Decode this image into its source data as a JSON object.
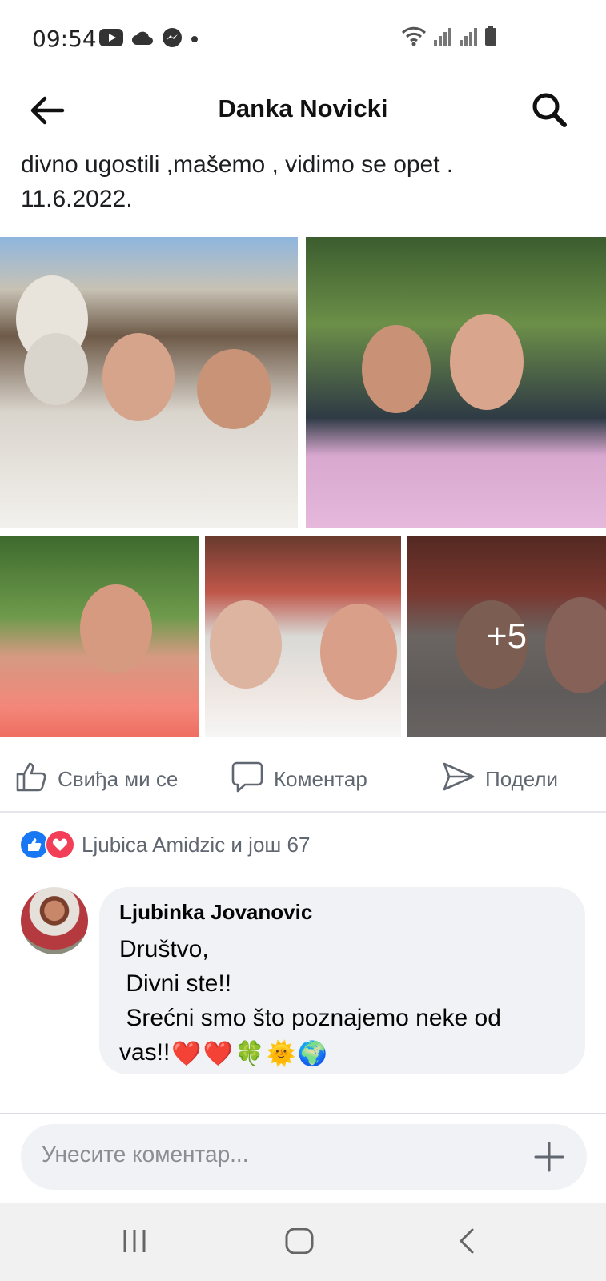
{
  "status_bar": {
    "time": "09:54",
    "left_icons": [
      "youtube-icon",
      "cloud-icon",
      "messenger-icon",
      "dot-icon"
    ],
    "right_icons": [
      "wifi-icon",
      "signal-icon",
      "signal-icon",
      "battery-icon"
    ]
  },
  "header": {
    "title": "Danka Novicki",
    "back_icon": "arrow-left-icon",
    "search_icon": "search-icon"
  },
  "post": {
    "caption": "divno ugostili ,mašemo , vidimo se opet .\n11.6.2022.",
    "more_photos_label": "+5"
  },
  "actions": {
    "like_label": "Свиђа ми се",
    "comment_label": "Коментар",
    "share_label": "Подели"
  },
  "reactions": {
    "summary": "Ljubica Amidzic и још 67",
    "types": [
      "like",
      "love"
    ],
    "colors": {
      "like": "#1877f2",
      "love": "#f33e58"
    }
  },
  "comment": {
    "author": "Ljubinka Jovanovic",
    "text": "Društvo,\n Divni ste!!\n Srećni smo što poznajemo neke od\nvas!!",
    "emojis": [
      "❤️",
      "❤️",
      "🍀",
      "🌞",
      "🌍"
    ]
  },
  "comment_input": {
    "placeholder": "Унесите коментар..."
  },
  "nav_bar": {
    "icons": [
      "recent-apps-icon",
      "home-icon",
      "back-icon"
    ]
  }
}
